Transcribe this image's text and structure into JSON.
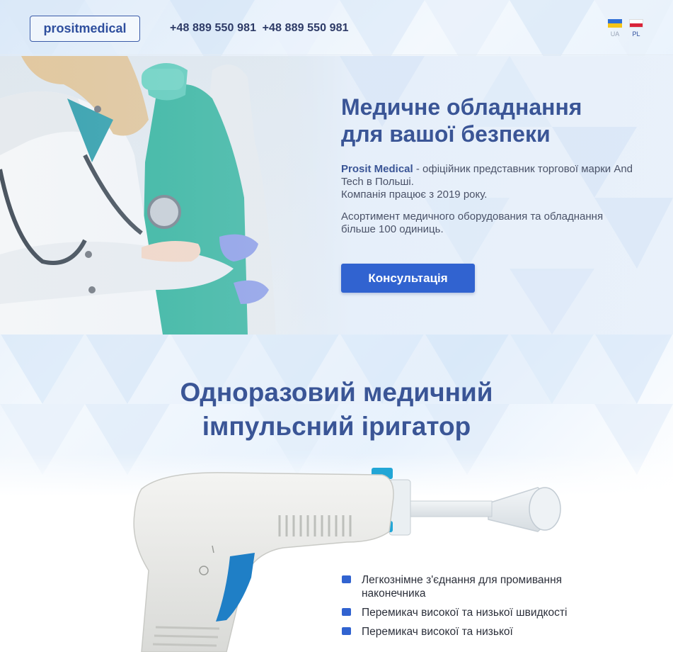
{
  "header": {
    "logo": "prositmedical",
    "phones": [
      "+48 889 550 981",
      "+48 889 550 981"
    ],
    "languages": [
      {
        "code": "UA",
        "active": false
      },
      {
        "code": "PL",
        "active": true
      }
    ]
  },
  "hero": {
    "title_line1": "Медичне обладнання",
    "title_line2": "для вашої безпеки",
    "brand": "Prosit Medical",
    "text1_rest": " - офіційник представник торгової марки And Tech в Польші.",
    "text1_line3": "Компанія працює з 2019 року.",
    "text2": "Асортимент медичного оборудования та обладнання більше 100 одиниць.",
    "button_label": "Консультація"
  },
  "product": {
    "title_line1": "Одноразовий медичний",
    "title_line2": "імпульсний іригатор",
    "features": [
      "Легкознімне з'єднання для промивання наконечника",
      "Перемикач високої та низької швидкості",
      "Перемикач високої та низької"
    ]
  },
  "colors": {
    "accent": "#3163d0",
    "title": "#3a5596",
    "logo_border": "#3a5ba8"
  }
}
